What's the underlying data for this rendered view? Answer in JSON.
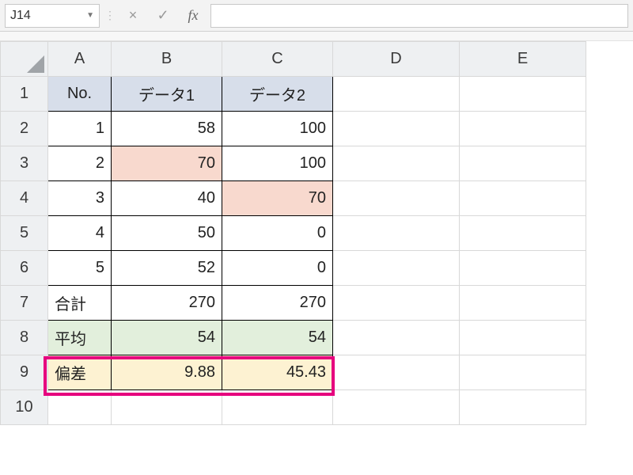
{
  "formula_bar": {
    "cell_ref": "J14",
    "cancel_tip": "×",
    "enter_tip": "✓",
    "fx_label": "fx",
    "value": ""
  },
  "columns": [
    "A",
    "B",
    "C",
    "D",
    "E"
  ],
  "row_numbers": [
    "1",
    "2",
    "3",
    "4",
    "5",
    "6",
    "7",
    "8",
    "9",
    "10"
  ],
  "header": {
    "a": "No.",
    "b": "データ1",
    "c": "データ2"
  },
  "rows": [
    {
      "no": "1",
      "d1": "58",
      "d2": "100"
    },
    {
      "no": "2",
      "d1": "70",
      "d2": "100"
    },
    {
      "no": "3",
      "d1": "40",
      "d2": "70"
    },
    {
      "no": "4",
      "d1": "50",
      "d2": "0"
    },
    {
      "no": "5",
      "d1": "52",
      "d2": "0"
    }
  ],
  "totals": {
    "label": "合計",
    "d1": "270",
    "d2": "270"
  },
  "average": {
    "label": "平均",
    "d1": "54",
    "d2": "54"
  },
  "stdev": {
    "label": "偏差",
    "d1": "9.88",
    "d2": "45.43"
  },
  "chart_data": {
    "type": "table",
    "title": "",
    "columns": [
      "No.",
      "データ1",
      "データ2"
    ],
    "rows": [
      [
        1,
        58,
        100
      ],
      [
        2,
        70,
        100
      ],
      [
        3,
        40,
        70
      ],
      [
        4,
        50,
        0
      ],
      [
        5,
        52,
        0
      ]
    ],
    "summary": {
      "合計": [
        270,
        270
      ],
      "平均": [
        54,
        54
      ],
      "偏差": [
        9.88,
        45.43
      ]
    }
  }
}
